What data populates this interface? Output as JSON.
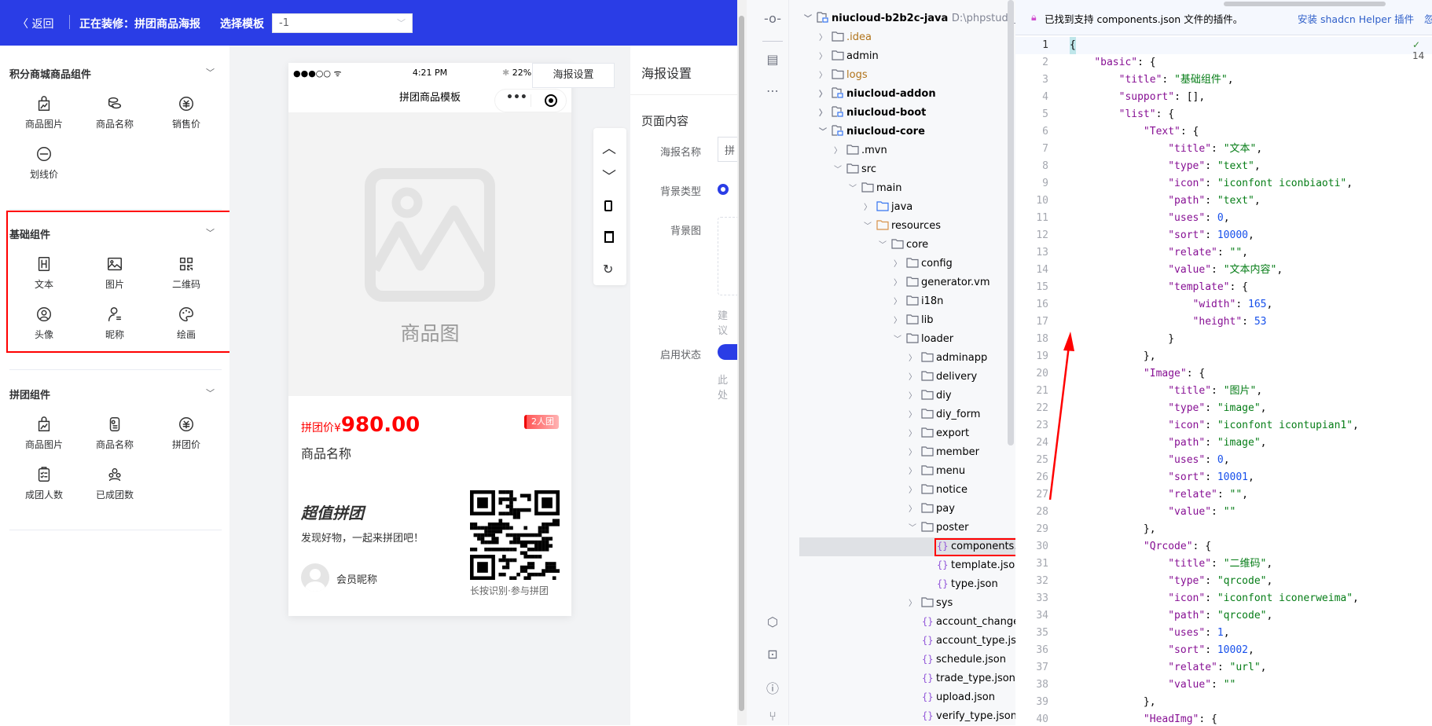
{
  "header": {
    "back_label": "返回",
    "editing_label": "正在装修：拼团商品海报",
    "template_label": "选择模板",
    "template_value": "-1",
    "bg_color": "#2a3de6"
  },
  "sidebar": {
    "sections": [
      {
        "title": "积分商城商品组件",
        "items": [
          {
            "label": "商品图片",
            "icon": "goods-image"
          },
          {
            "label": "商品名称",
            "icon": "goods-name"
          },
          {
            "label": "销售价",
            "icon": "price"
          },
          {
            "label": "划线价",
            "icon": "line-price"
          }
        ]
      },
      {
        "title": "基础组件",
        "items": [
          {
            "label": "文本",
            "icon": "text"
          },
          {
            "label": "图片",
            "icon": "image"
          },
          {
            "label": "二维码",
            "icon": "qrcode"
          },
          {
            "label": "头像",
            "icon": "avatar"
          },
          {
            "label": "昵称",
            "icon": "nickname"
          },
          {
            "label": "绘画",
            "icon": "draw"
          }
        ]
      },
      {
        "title": "拼团组件",
        "items": [
          {
            "label": "商品图片",
            "icon": "goods-image"
          },
          {
            "label": "商品名称",
            "icon": "goods-name2"
          },
          {
            "label": "拼团价",
            "icon": "price"
          },
          {
            "label": "成团人数",
            "icon": "group-size"
          },
          {
            "label": "已成团数",
            "icon": "groups-done"
          }
        ]
      }
    ],
    "highlight_color": "#ff0000"
  },
  "phone": {
    "signal": "●●●○○",
    "time": "4:21 PM",
    "battery": "22%",
    "title": "拼团商品模板",
    "image_placeholder": "商品图",
    "price_prefix": "拼团价¥",
    "price": "980.00",
    "group_badge": "2人团",
    "goods_name": "商品名称",
    "slogan_title": "超值拼团",
    "slogan": "发现好物，一起来拼团吧！",
    "member_name": "会员昵称",
    "qr_caption": "长按识别·参与拼团",
    "price_color": "#ff0000"
  },
  "poster_settings_button": "海报设置",
  "toolbar": [
    "move-up",
    "move-down",
    "copy",
    "delete",
    "reset"
  ],
  "settings": {
    "title": "海报设置",
    "section": "页面内容",
    "name_label": "海报名称",
    "name_value": "拼",
    "bg_type_label": "背景类型",
    "bg_image_label": "背景图",
    "hint": "建议",
    "status_label": "启用状态",
    "status_hint": "此处"
  },
  "ide": {
    "project": {
      "name": "niucloud-b2b2c-java",
      "path": "D:\\phpstudy_pro\\"
    },
    "tree": [
      {
        "label": "niucloud-b2b2c-java",
        "level": 0,
        "kind": "module",
        "open": true,
        "bold": true
      },
      {
        "label": ".idea",
        "level": 1,
        "kind": "folder",
        "open": false,
        "excluded": true
      },
      {
        "label": "admin",
        "level": 1,
        "kind": "folder",
        "open": false
      },
      {
        "label": "logs",
        "level": 1,
        "kind": "folder",
        "open": false,
        "excluded": true
      },
      {
        "label": "niucloud-addon",
        "level": 1,
        "kind": "module",
        "open": false,
        "bold": true
      },
      {
        "label": "niucloud-boot",
        "level": 1,
        "kind": "module",
        "open": false,
        "bold": true
      },
      {
        "label": "niucloud-core",
        "level": 1,
        "kind": "module",
        "open": true,
        "bold": true
      },
      {
        "label": ".mvn",
        "level": 2,
        "kind": "folder",
        "open": false
      },
      {
        "label": "src",
        "level": 2,
        "kind": "folder",
        "open": true
      },
      {
        "label": "main",
        "level": 3,
        "kind": "folder",
        "open": true
      },
      {
        "label": "java",
        "level": 4,
        "kind": "source",
        "open": false
      },
      {
        "label": "resources",
        "level": 4,
        "kind": "resource",
        "open": true
      },
      {
        "label": "core",
        "level": 5,
        "kind": "folder",
        "open": true
      },
      {
        "label": "config",
        "level": 6,
        "kind": "folder",
        "open": false
      },
      {
        "label": "generator.vm",
        "level": 6,
        "kind": "folder",
        "open": false
      },
      {
        "label": "i18n",
        "level": 6,
        "kind": "folder",
        "open": false
      },
      {
        "label": "lib",
        "level": 6,
        "kind": "folder",
        "open": false
      },
      {
        "label": "loader",
        "level": 6,
        "kind": "folder",
        "open": true
      },
      {
        "label": "adminapp",
        "level": 7,
        "kind": "folder",
        "open": false
      },
      {
        "label": "delivery",
        "level": 7,
        "kind": "folder",
        "open": false
      },
      {
        "label": "diy",
        "level": 7,
        "kind": "folder",
        "open": false
      },
      {
        "label": "diy_form",
        "level": 7,
        "kind": "folder",
        "open": false
      },
      {
        "label": "export",
        "level": 7,
        "kind": "folder",
        "open": false
      },
      {
        "label": "member",
        "level": 7,
        "kind": "folder",
        "open": false
      },
      {
        "label": "menu",
        "level": 7,
        "kind": "folder",
        "open": false
      },
      {
        "label": "notice",
        "level": 7,
        "kind": "folder",
        "open": false
      },
      {
        "label": "pay",
        "level": 7,
        "kind": "folder",
        "open": false
      },
      {
        "label": "poster",
        "level": 7,
        "kind": "folder",
        "open": true
      },
      {
        "label": "components.js",
        "level": 8,
        "kind": "json",
        "selected": true
      },
      {
        "label": "template.json",
        "level": 8,
        "kind": "json"
      },
      {
        "label": "type.json",
        "level": 8,
        "kind": "json"
      },
      {
        "label": "sys",
        "level": 7,
        "kind": "folder",
        "open": false
      },
      {
        "label": "account_change_ty",
        "level": 7,
        "kind": "json"
      },
      {
        "label": "account_type.json",
        "level": 7,
        "kind": "json"
      },
      {
        "label": "schedule.json",
        "level": 7,
        "kind": "json"
      },
      {
        "label": "trade_type.json",
        "level": 7,
        "kind": "json"
      },
      {
        "label": "upload.json",
        "level": 7,
        "kind": "json"
      },
      {
        "label": "verify_type.json",
        "level": 7,
        "kind": "json"
      }
    ],
    "banner": {
      "text": "已找到支持 components.json 文件的插件。",
      "action": "安装 shadcn Helper 插件",
      "more": "忽"
    },
    "inspection": "14",
    "code": [
      "{",
      "    \"basic\": {",
      "        \"title\": \"基础组件\",",
      "        \"support\": [],",
      "        \"list\": {",
      "            \"Text\": {",
      "                \"title\": \"文本\",",
      "                \"type\": \"text\",",
      "                \"icon\": \"iconfont iconbiaoti\",",
      "                \"path\": \"text\",",
      "                \"uses\": 0,",
      "                \"sort\": 10000,",
      "                \"relate\": \"\",",
      "                \"value\": \"文本内容\",",
      "                \"template\": {",
      "                    \"width\": 165,",
      "                    \"height\": 53",
      "                }",
      "            },",
      "            \"Image\": {",
      "                \"title\": \"图片\",",
      "                \"type\": \"image\",",
      "                \"icon\": \"iconfont icontupian1\",",
      "                \"path\": \"image\",",
      "                \"uses\": 0,",
      "                \"sort\": 10001,",
      "                \"relate\": \"\",",
      "                \"value\": \"\"",
      "            },",
      "            \"Qrcode\": {",
      "                \"title\": \"二维码\",",
      "                \"type\": \"qrcode\",",
      "                \"icon\": \"iconfont iconerweima\",",
      "                \"path\": \"qrcode\",",
      "                \"uses\": 1,",
      "                \"sort\": 10002,",
      "                \"relate\": \"url\",",
      "                \"value\": \"\"",
      "            },",
      "            \"HeadImg\": {"
    ]
  }
}
